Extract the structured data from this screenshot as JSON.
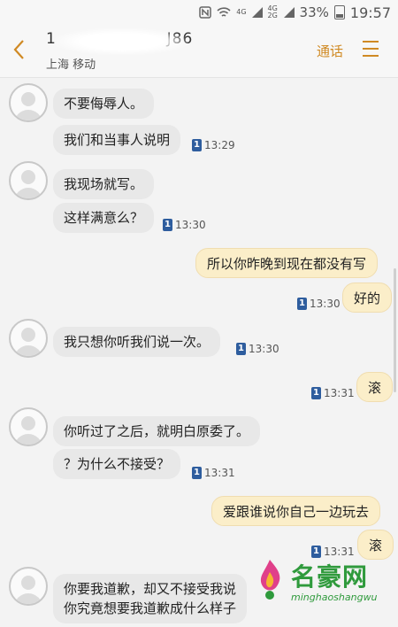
{
  "status_bar": {
    "signal_labels": [
      "4G",
      "4G 2G"
    ],
    "battery": "33%",
    "time": "19:57"
  },
  "header": {
    "back_icon": "chevron-left-icon",
    "number_visible_start": "1",
    "number_visible_end": "J86",
    "carrier": "上海 移动",
    "call_label": "通话",
    "menu_icon": "menu-icon"
  },
  "messages": [
    {
      "dir": "in",
      "text": "不要侮辱人。"
    },
    {
      "dir": "in",
      "text": "我们和当事人说明",
      "sim": "1",
      "time": "13:29"
    },
    {
      "dir": "in",
      "text": "我现场就写。"
    },
    {
      "dir": "in",
      "text": "这样满意么？",
      "sim": "1",
      "time": "13:30"
    },
    {
      "dir": "out",
      "text": "所以你昨晚到现在都没有写"
    },
    {
      "dir": "out",
      "text": "好的",
      "sim": "1",
      "time": "13:30"
    },
    {
      "dir": "in",
      "text": "我只想你听我们说一次。",
      "sim": "1",
      "time": "13:30"
    },
    {
      "dir": "out",
      "text": "滚",
      "sim": "1",
      "time": "13:31"
    },
    {
      "dir": "in",
      "text": "你听过了之后，就明白原委了。"
    },
    {
      "dir": "in",
      "text": "？为什么不接受？",
      "sim": "1",
      "time": "13:31"
    },
    {
      "dir": "out",
      "text": "爱跟谁说你自己一边玩去"
    },
    {
      "dir": "out",
      "text": "滚",
      "sim": "1",
      "time": "13:31"
    },
    {
      "dir": "in",
      "text_line1": "你要我道歉，却又不接受我说",
      "text_line2": "你究竟想要我道歉成什么样子"
    }
  ],
  "watermark": {
    "text": "名豪网",
    "sub": "minghaoshangwu"
  },
  "colors": {
    "accent": "#d08a24",
    "incoming_bubble": "#e8e8e8",
    "outgoing_bubble": "#fbeec9",
    "sim_badge": "#2e5d9e",
    "watermark": "#2f9a3c"
  }
}
